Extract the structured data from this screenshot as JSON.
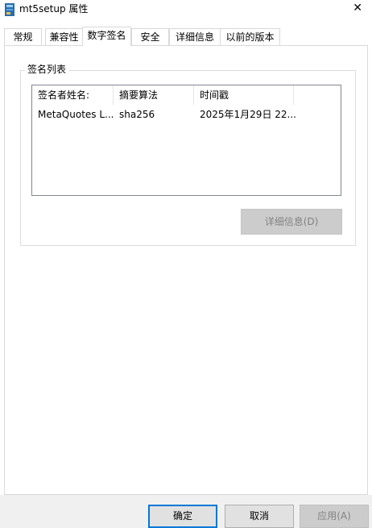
{
  "window": {
    "title": "mt5setup 属性",
    "close_glyph": "✕"
  },
  "tabs": [
    {
      "label": "常规"
    },
    {
      "label": "兼容性"
    },
    {
      "label": "数字签名",
      "active": true
    },
    {
      "label": "安全"
    },
    {
      "label": "详细信息"
    },
    {
      "label": "以前的版本"
    }
  ],
  "signature_group": {
    "label": "签名列表",
    "columns": [
      "签名者姓名:",
      "摘要算法",
      "时间戳"
    ],
    "rows": [
      [
        "MetaQuotes L...",
        "sha256",
        "2025年1月29日 22..."
      ]
    ],
    "details_button": "详细信息(D)"
  },
  "footer": {
    "ok_label": "确定",
    "cancel_label": "取消",
    "apply_label": "应用(A)"
  },
  "colors": {
    "accent": "#0078d7",
    "disabled_text": "#838383"
  },
  "icons": {
    "app": "installer-icon",
    "close": "close-icon"
  }
}
